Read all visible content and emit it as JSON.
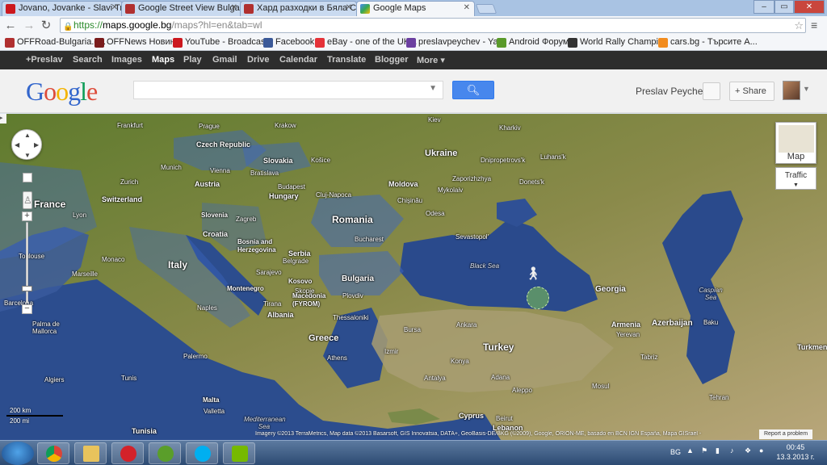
{
  "tabs": [
    {
      "title": "Jovano, Jovanke - Slavi Tr",
      "icon": "youtube-icon",
      "active": false
    },
    {
      "title": "Google Street View Bulgar",
      "icon": "offroad-icon",
      "active": false
    },
    {
      "title": "Хард разходки в Бяла Сла",
      "icon": "offroad-icon",
      "active": false
    },
    {
      "title": "Google Maps",
      "icon": "google-maps-icon",
      "active": true
    }
  ],
  "window_controls": {
    "minimize": "–",
    "maximize": "▭",
    "close": "✕"
  },
  "address": {
    "scheme": "https://",
    "host": "maps.google.bg",
    "path": "/maps?hl=en&tab=wl"
  },
  "bookmarks": [
    {
      "label": "OFFRoad-Bulgaria.c...",
      "icon": "offroad-icon"
    },
    {
      "label": "OFFNews Новини",
      "icon": "offnews-icon"
    },
    {
      "label": "YouTube - Broadcas...",
      "icon": "youtube-icon"
    },
    {
      "label": "Facebook",
      "icon": "facebook-icon"
    },
    {
      "label": "eBay - one of the UK...",
      "icon": "ebay-icon"
    },
    {
      "label": "preslavpeychev - Ya...",
      "icon": "yahoo-mail-icon"
    },
    {
      "label": "Android Форум",
      "icon": "android-icon"
    },
    {
      "label": "World Rally Champi...",
      "icon": "wrc-icon"
    },
    {
      "label": "cars.bg - Търсите А...",
      "icon": "cars-bg-icon"
    }
  ],
  "gbar": {
    "items": [
      "+Preslav",
      "Search",
      "Images",
      "Maps",
      "Play",
      "Gmail",
      "Drive",
      "Calendar",
      "Translate",
      "Blogger",
      "More ▾"
    ],
    "active": "Maps"
  },
  "header": {
    "logo": [
      "G",
      "o",
      "o",
      "g",
      "l",
      "e"
    ],
    "logo_colors": [
      "#3366cc",
      "#dd4b39",
      "#f4b400",
      "#3366cc",
      "#0f9d58",
      "#dd4b39"
    ],
    "search_value": "",
    "username": "Preslav Peychev",
    "share_label": "Share"
  },
  "map": {
    "controls": {
      "map_type": "Map",
      "traffic": "Traffic",
      "zoom_in": "+",
      "zoom_out": "−"
    },
    "scale": {
      "km": "200 km",
      "mi": "200 mi"
    },
    "attribution": "Imagery ©2013 TerraMetrics, Map data ©2013 Basarsoft, GIS Innovatsia, DATA+, GeoBasis-DE/BKG (©2009), Google, ORION-ME, basado en BCN IGN España, Mapa GISrael -",
    "report": "Report a problem",
    "countries": [
      "Ukraine",
      "Czech Republic",
      "Slovakia",
      "Austria",
      "Hungary",
      "Slovenia",
      "Croatia",
      "Bosnia and Herzegovina",
      "Serbia",
      "Montenegro",
      "Kosovo",
      "Macedonia (FYROM)",
      "Albania",
      "Romania",
      "Moldova",
      "Bulgaria",
      "Greece",
      "Turkey",
      "Georgia",
      "Armenia",
      "Azerbaijan",
      "Italy",
      "France",
      "Switzerland",
      "Cyprus",
      "Lebanon",
      "Tunisia",
      "Malta",
      "Turkmenistan"
    ],
    "cities": [
      "Kiev",
      "Kharkiv",
      "Frankfurt",
      "Prague",
      "Krakow",
      "Munich",
      "Vienna",
      "Bratislava",
      "Košice",
      "Dnipropetrovs'k",
      "Luhans'k",
      "Zaporizhzhya",
      "Donets'k",
      "Mykolaiv",
      "Chişinău",
      "Cluj-Napoca",
      "Budapest",
      "Odesa",
      "Zurich",
      "Lyon",
      "Zagreb",
      "Bucharest",
      "Sevastopol'",
      "Monaco",
      "Toulouse",
      "Marseille",
      "Barcelona",
      "Sarajevo",
      "Belgrade",
      "Skopje",
      "Tirana",
      "Plovdiv",
      "Thessaloniki",
      "Bursa",
      "Ankara",
      "Athens",
      "Izmir",
      "Konya",
      "Adana",
      "Antalya",
      "Aleppo",
      "Mosul",
      "Tehran",
      "Tabriz",
      "Baku",
      "Yerevan",
      "Palma de Mallorca",
      "Naples",
      "Palermo",
      "Algiers",
      "Tunis",
      "Beirut",
      "Valletta"
    ],
    "seas": [
      "Black Sea",
      "Caspian Sea",
      "Mediterranean Sea"
    ]
  },
  "taskbar": {
    "apps": [
      "start-button",
      "chrome-icon",
      "explorer-icon",
      "opera-icon",
      "utorrent-icon",
      "skype-icon",
      "nvidia-icon"
    ],
    "lang": "BG",
    "time": "00:45",
    "date": "13.3.2013 г."
  }
}
